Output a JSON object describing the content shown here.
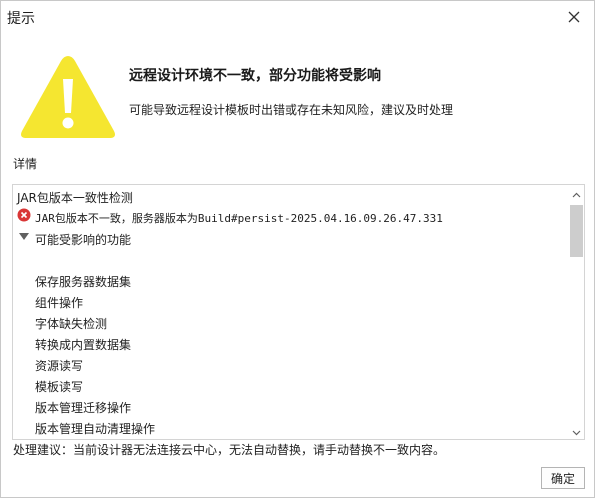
{
  "window": {
    "title": "提示"
  },
  "colors": {
    "warning_yellow": "#f5e630",
    "error_red": "#d93636",
    "scrollbar_thumb": "#cdcdcd"
  },
  "icons": {
    "warning": "warning-triangle-icon",
    "close": "close-icon",
    "error": "error-circle-icon",
    "expand": "expand-triangle-icon"
  },
  "message": {
    "headline": "远程设计环境不一致，部分功能将受影响",
    "subline": "可能导致远程设计模板时出错或存在未知风险，建议及时处理"
  },
  "details": {
    "label": "详情",
    "check_title": "JAR包版本一致性检测",
    "error_line": "JAR包版本不一致，服务器版本为Build#persist-2025.04.16.09.26.47.331",
    "affected_header": "可能受影响的功能",
    "affected_items": [
      "保存服务器数据集",
      "组件操作",
      "字体缺失检测",
      "转换成内置数据集",
      "资源读写",
      "模板读写",
      "版本管理迁移操作",
      "版本管理自动清理操作"
    ]
  },
  "suggestion": "处理建议：当前设计器无法连接云中心，无法自动替换，请手动替换不一致内容。",
  "buttons": {
    "ok": "确定"
  }
}
